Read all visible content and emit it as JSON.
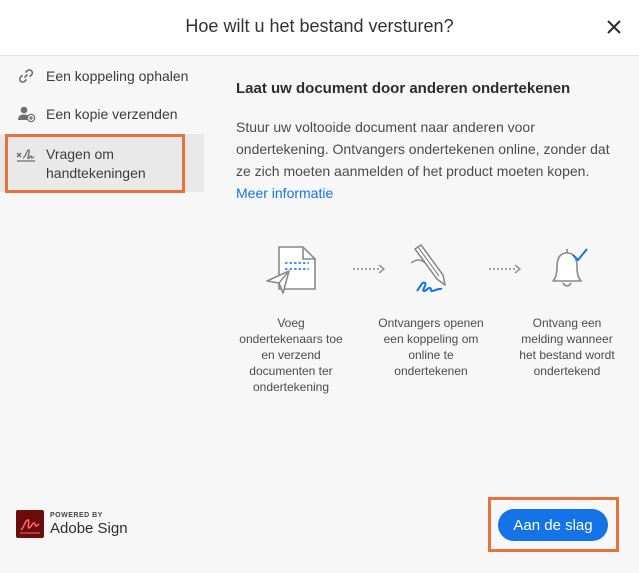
{
  "dialog": {
    "title": "Hoe wilt u het bestand versturen?"
  },
  "sidebar": {
    "items": [
      {
        "label": "Een koppeling ophalen",
        "icon": "link-icon"
      },
      {
        "label": "Een kopie verzenden",
        "icon": "add-person-icon"
      },
      {
        "label": "Vragen om handtekeningen",
        "icon": "signature-icon",
        "active": true
      }
    ]
  },
  "main": {
    "heading": "Laat uw document door anderen ondertekenen",
    "description": "Stuur uw voltooide document naar anderen voor ondertekening. Ontvangers ondertekenen online, zonder dat ze zich moeten aanmelden of het product moeten kopen.",
    "more_link": "Meer informatie",
    "steps": [
      {
        "text": "Voeg ondertekenaars toe en verzend documenten ter ondertekening",
        "icon": "send-document-icon"
      },
      {
        "text": "Ontvangers openen een koppeling om online te ondertekenen",
        "icon": "pen-sign-icon"
      },
      {
        "text": "Ontvang een melding wanneer het bestand wordt ondertekend",
        "icon": "bell-check-icon"
      }
    ]
  },
  "footer": {
    "powered_by": "POWERED BY",
    "brand": "Adobe Sign",
    "cta_label": "Aan de slag"
  },
  "colors": {
    "accent": "#1473e6",
    "highlight": "#e8733a",
    "brand_mark": "#6b0d0d"
  }
}
